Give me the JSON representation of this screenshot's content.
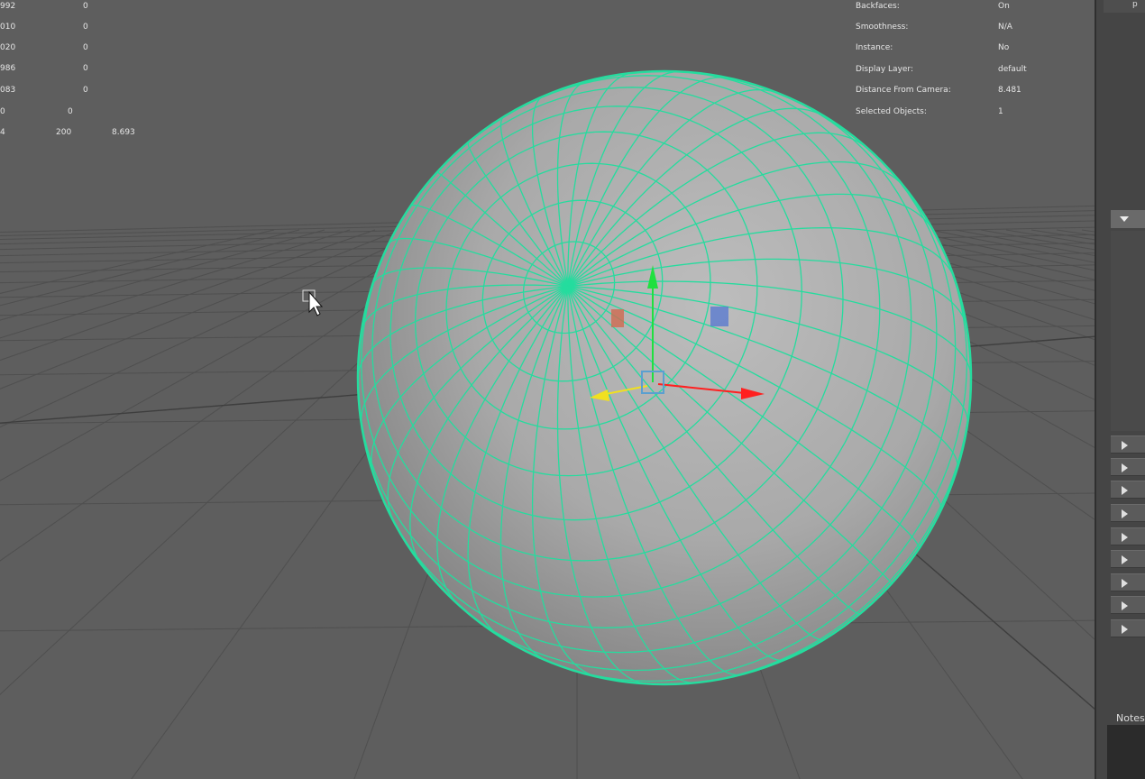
{
  "hud_left": {
    "rows": [
      {
        "a": "992",
        "b": "0"
      },
      {
        "a": "010",
        "b": "0"
      },
      {
        "a": "020",
        "b": "0"
      },
      {
        "a": "986",
        "b": "0"
      },
      {
        "a": "083",
        "b": "0"
      }
    ],
    "row6": {
      "a": "0",
      "b": "0"
    },
    "row7": {
      "a": "4",
      "b": "200",
      "c": "8.693"
    }
  },
  "hud_right": [
    {
      "label": "Backfaces:",
      "value": "On"
    },
    {
      "label": "Smoothness:",
      "value": "N/A"
    },
    {
      "label": "Instance:",
      "value": "No"
    },
    {
      "label": "Display Layer:",
      "value": "default"
    },
    {
      "label": "Distance From Camera:",
      "value": "8.481"
    },
    {
      "label": "Selected Objects:",
      "value": "1"
    }
  ],
  "side": {
    "top_label": "p",
    "notes_label": "Notes"
  },
  "colors": {
    "wireframe": "#25dc9e",
    "axis_x": "#ff2020",
    "axis_y": "#20e040",
    "axis_z": "#f0e020"
  }
}
